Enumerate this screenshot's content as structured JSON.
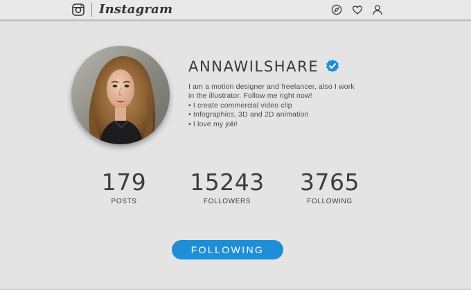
{
  "app": {
    "brand": "Instagram",
    "icons": {
      "logo": "instagram-camera-icon",
      "explore": "compass-icon",
      "activity": "heart-icon",
      "profile": "user-icon",
      "verified": "verified-badge-icon"
    }
  },
  "profile": {
    "username": "ANNAWILSHARE",
    "verified": true,
    "bio": [
      "I am a motion designer and freelancer, also I work",
      "in the illustrator.  Follow me right now!",
      "• I create commercial video clip",
      "• Infographics, 3D and 2D animation",
      "• I love my job!"
    ]
  },
  "stats": [
    {
      "value": "179",
      "label": "POSTS"
    },
    {
      "value": "15243",
      "label": "FOLLOWERS"
    },
    {
      "value": "3765",
      "label": "FOLLOWING"
    }
  ],
  "follow_button": {
    "label": "FOLLOWING"
  },
  "colors": {
    "background": "#e4e4e4",
    "accent": "#1e8fd6",
    "text": "#3c3c3c"
  }
}
